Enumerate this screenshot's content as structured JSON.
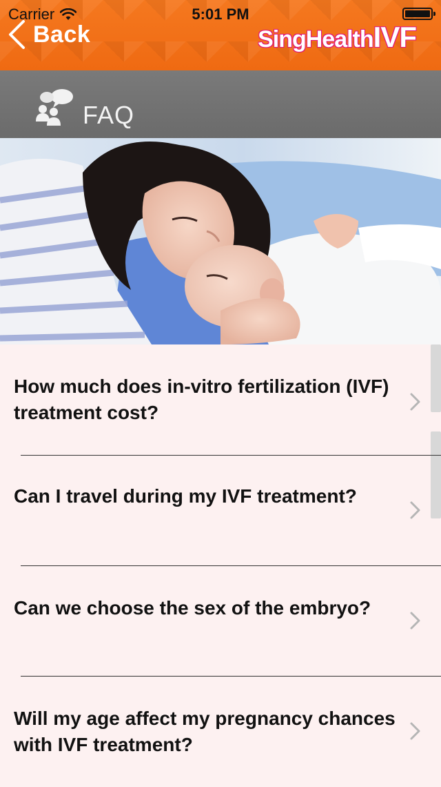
{
  "status_bar": {
    "carrier": "Carrier",
    "time": "5:01 PM"
  },
  "nav": {
    "back_label": "Back",
    "logo_part1": "SingHealth",
    "logo_part2": "IVF",
    "accent_color": "#f0701a",
    "logo_color": "#e0147b"
  },
  "section": {
    "title": "FAQ",
    "icon": "people-chat-icon"
  },
  "faq_items": [
    {
      "question": "How much does in-vitro fertilization (IVF) treatment cost?"
    },
    {
      "question": "Can I travel during my IVF treatment?"
    },
    {
      "question": "Can we choose the sex of the embryo?"
    },
    {
      "question": "Will my age affect my pregnancy chances with IVF treatment?"
    }
  ]
}
